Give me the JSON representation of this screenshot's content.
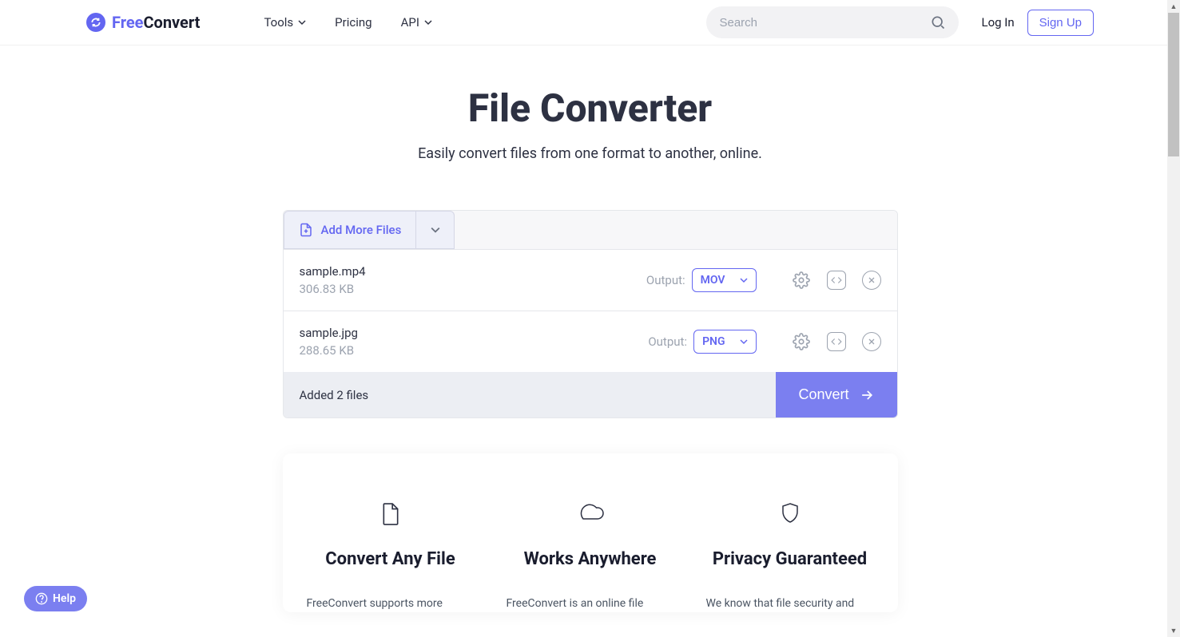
{
  "header": {
    "logo_free": "Free",
    "logo_convert": "Convert",
    "nav": {
      "tools": "Tools",
      "pricing": "Pricing",
      "api": "API"
    },
    "search_placeholder": "Search",
    "login": "Log In",
    "signup": "Sign Up"
  },
  "hero": {
    "title": "File Converter",
    "subtitle": "Easily convert files from one format to another, online."
  },
  "panel": {
    "add_more": "Add More Files",
    "output_label": "Output:",
    "files": [
      {
        "name": "sample.mp4",
        "size": "306.83 KB",
        "output": "MOV"
      },
      {
        "name": "sample.jpg",
        "size": "288.65 KB",
        "output": "PNG"
      }
    ],
    "added_text": "Added 2 files",
    "convert": "Convert"
  },
  "info": {
    "cols": [
      {
        "title": "Convert Any File",
        "text": "FreeConvert supports more"
      },
      {
        "title": "Works Anywhere",
        "text": "FreeConvert is an online file"
      },
      {
        "title": "Privacy Guaranteed",
        "text": "We know that file security and"
      }
    ]
  },
  "help": "Help"
}
